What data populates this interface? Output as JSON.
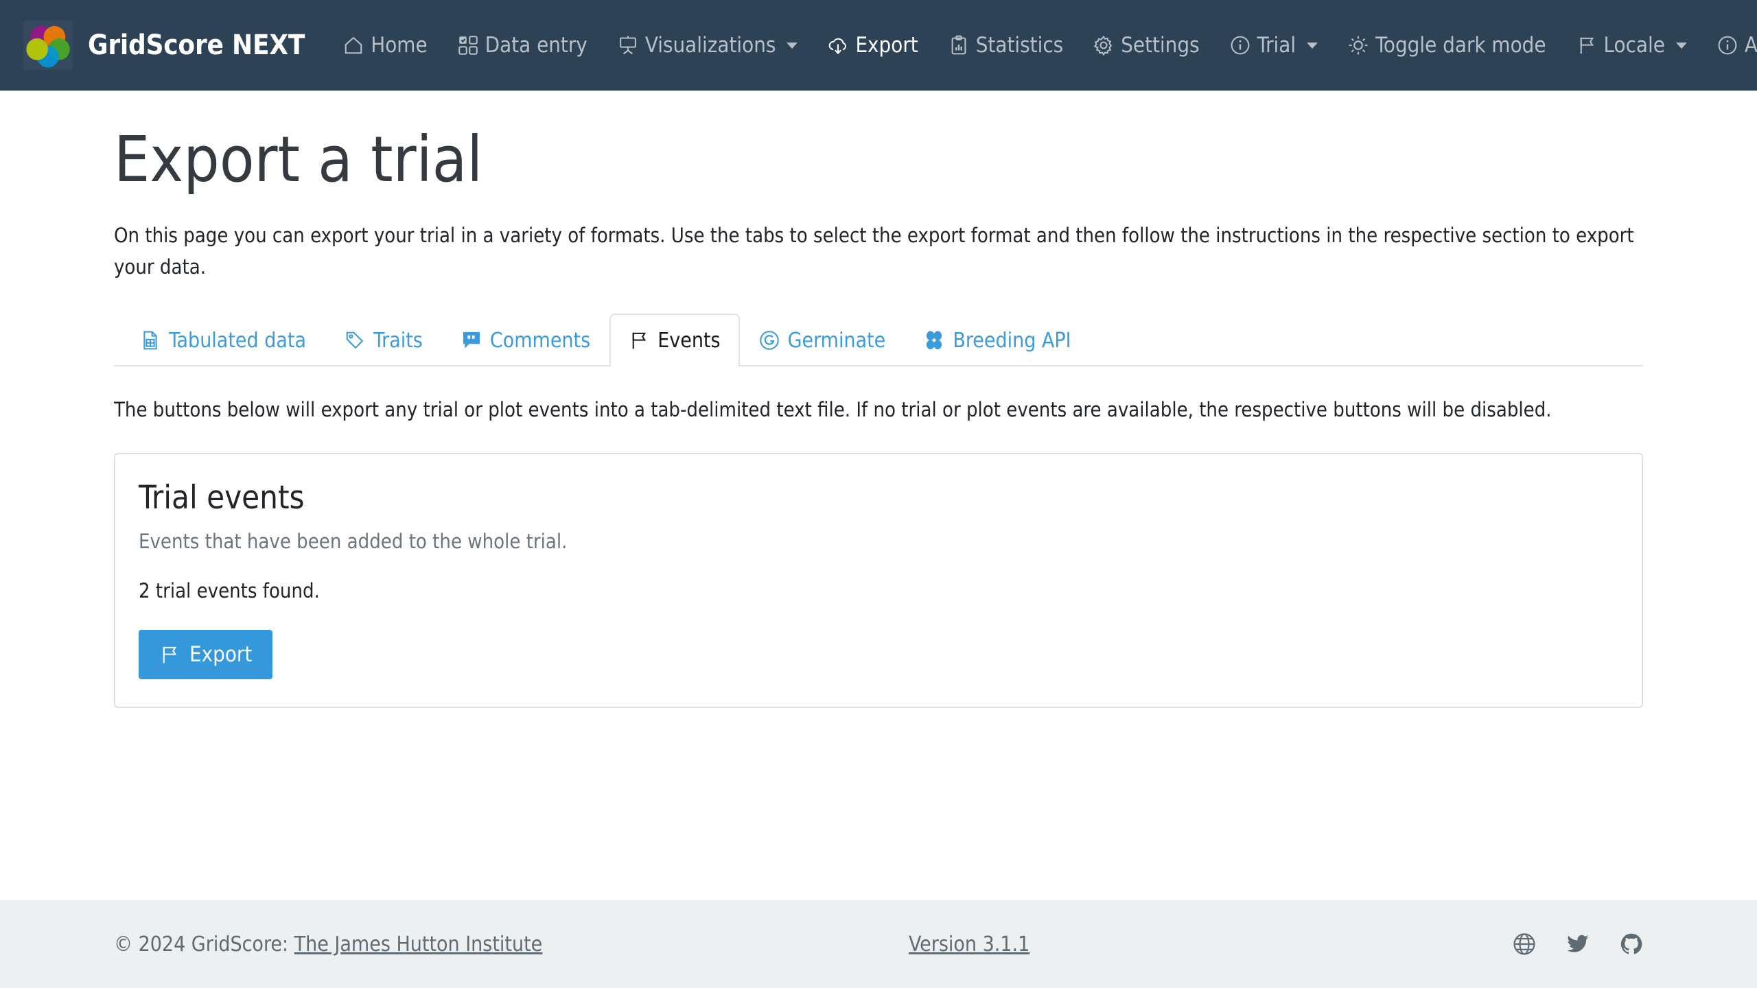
{
  "navbar": {
    "brand_title": "GridScore NEXT",
    "logo_icon": "gridscore-flower-logo",
    "left_items": [
      {
        "label": "Home",
        "icon": "house-icon",
        "active": false,
        "caret": false
      },
      {
        "label": "Data entry",
        "icon": "grid-check-icon",
        "active": false,
        "caret": false
      },
      {
        "label": "Visualizations",
        "icon": "easel-icon",
        "active": false,
        "caret": true
      },
      {
        "label": "Export",
        "icon": "cloud-download-icon",
        "active": true,
        "caret": false
      },
      {
        "label": "Statistics",
        "icon": "clipboard-chart-icon",
        "active": false,
        "caret": false
      },
      {
        "label": "Settings",
        "icon": "gear-icon",
        "active": false,
        "caret": false
      }
    ],
    "right_items": [
      {
        "label": "Trial",
        "icon": "info-circle-icon",
        "active": false,
        "caret": true
      },
      {
        "label": "Toggle dark mode",
        "icon": "sun-icon",
        "active": false,
        "caret": false
      },
      {
        "label": "Locale",
        "icon": "flag-icon",
        "active": false,
        "caret": true
      },
      {
        "label": "About",
        "icon": "info-circle-icon",
        "active": false,
        "caret": false
      }
    ]
  },
  "page": {
    "title": "Export a trial",
    "description": "On this page you can export your trial in a variety of formats. Use the tabs to select the export format and then follow the instructions in the respective section to export your data."
  },
  "tabs": [
    {
      "label": "Tabulated data",
      "icon": "table-file-icon",
      "active": false
    },
    {
      "label": "Traits",
      "icon": "tag-icon",
      "active": false
    },
    {
      "label": "Comments",
      "icon": "comment-icon",
      "active": false
    },
    {
      "label": "Events",
      "icon": "flag-icon",
      "active": true
    },
    {
      "label": "Germinate",
      "icon": "germinate-circle-icon",
      "active": false
    },
    {
      "label": "Breeding API",
      "icon": "brapi-icon",
      "active": false
    }
  ],
  "events_tab": {
    "intro": "The buttons below will export any trial or plot events into a tab-delimited text file. If no trial or plot events are available, the respective buttons will be disabled.",
    "card": {
      "title": "Trial events",
      "subtitle": "Events that have been added to the whole trial.",
      "count_text": "2 trial events found.",
      "button_label": "Export",
      "button_icon": "flag-icon"
    }
  },
  "footer": {
    "copyright_prefix": "© 2024 GridScore: ",
    "institute_link": "The James Hutton Institute",
    "version": "Version 3.1.1",
    "social": [
      {
        "name": "globe-icon"
      },
      {
        "name": "twitter-icon"
      },
      {
        "name": "github-icon"
      }
    ]
  },
  "colors": {
    "navbar_bg": "#2e4255",
    "accent": "#3498db",
    "tab_link": "#3b9cd9",
    "footer_bg": "#ecf0f1",
    "muted_text": "#6c757d"
  }
}
